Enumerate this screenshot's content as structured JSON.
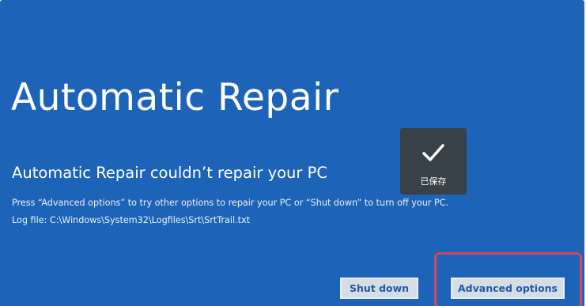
{
  "screen": {
    "title": "Automatic Repair",
    "subtitle": "Automatic Repair couldn’t repair your PC",
    "description": "Press “Advanced options” to try other options to repair your PC or “Shut down” to turn off your PC.",
    "log_file": "Log file: C:\\Windows\\System32\\Logfiles\\Srt\\SrtTrail.txt",
    "background_color": "#1d64b8"
  },
  "buttons": {
    "shutdown_label": "Shut down",
    "advanced_label": "Advanced options"
  },
  "toast": {
    "icon": "checkmark-icon",
    "label": "已保存"
  },
  "annotation": {
    "highlight_color": "#d6455a"
  }
}
